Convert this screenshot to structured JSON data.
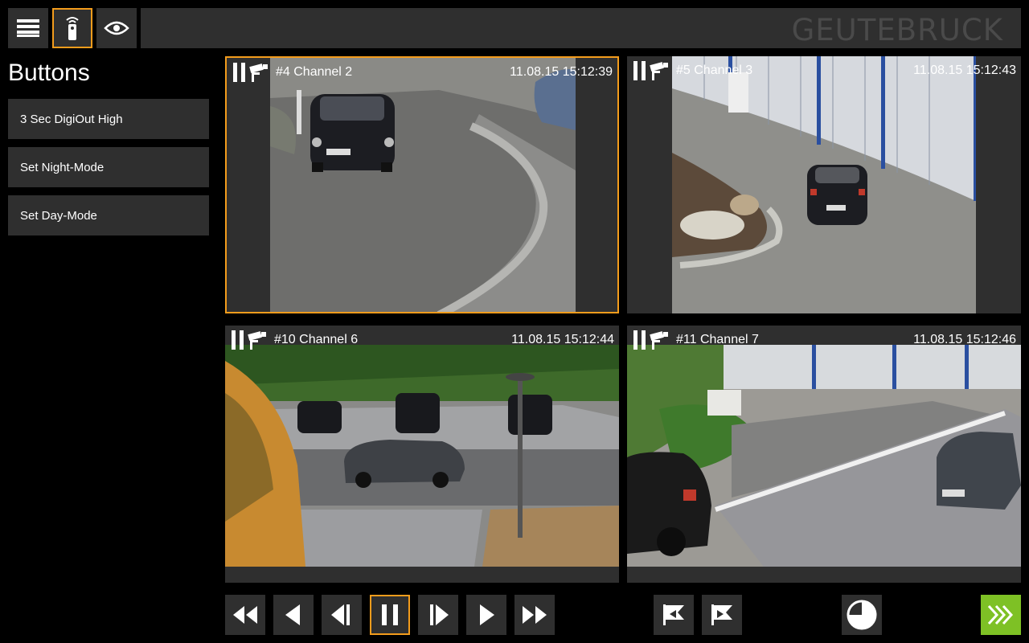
{
  "header": {
    "brand": "GEUTEBRUCK",
    "menu_icon": "hamburger-menu-icon",
    "remote_icon": "remote-control-icon",
    "view_icon": "eye-icon"
  },
  "panel": {
    "title": "Buttons",
    "buttons": [
      {
        "label": "3 Sec DigiOut High"
      },
      {
        "label": "Set Night-Mode"
      },
      {
        "label": "Set Day-Mode"
      }
    ]
  },
  "tiles": [
    {
      "name": "#4 Channel 2",
      "timestamp": "11.08.15 15:12:39",
      "state": "paused",
      "selected": true
    },
    {
      "name": "#5 Channel 3",
      "timestamp": "11.08.15 15:12:43",
      "state": "paused",
      "selected": false
    },
    {
      "name": "#10 Channel 6",
      "timestamp": "11.08.15 15:12:44",
      "state": "paused",
      "selected": false
    },
    {
      "name": "#11 Channel 7",
      "timestamp": "11.08.15 15:12:46",
      "state": "paused",
      "selected": false
    }
  ],
  "controls": {
    "playback": [
      "fast-rewind-icon",
      "play-reverse-icon",
      "step-back-icon",
      "pause-icon",
      "step-forward-icon",
      "play-icon",
      "fast-forward-icon"
    ],
    "active_playback": "pause-icon",
    "flags": [
      "flag-previous-icon",
      "flag-next-icon"
    ],
    "clock_icon": "clock-pie-icon",
    "live_icon": "live-forward-icon"
  },
  "colors": {
    "accent": "#f39c1c",
    "panel_bg": "#2f2f2f",
    "background": "#000000",
    "live_green": "#7ec125"
  }
}
